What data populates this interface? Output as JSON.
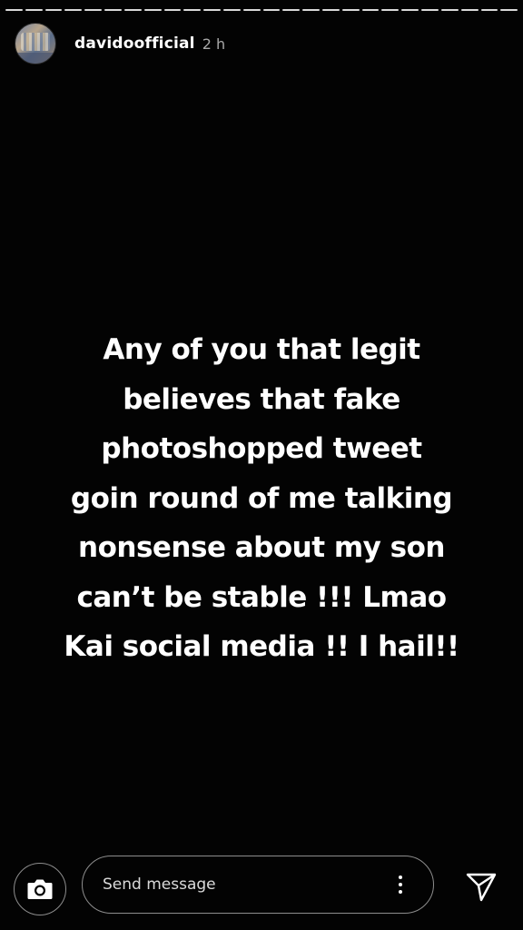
{
  "progress": {
    "segments": 26
  },
  "header": {
    "username": "davidoofficial",
    "time": "2 h"
  },
  "story": {
    "lines": [
      "Any of you that legit",
      "believes that fake",
      "photoshopped tweet",
      "goin round of me talking",
      "nonsense about my son",
      "can’t be stable !!! Lmao",
      "Kai social media !! I hail!!"
    ]
  },
  "footer": {
    "message_placeholder": "Send message",
    "camera_icon": "camera-icon",
    "more_icon": "more-vertical-icon",
    "send_icon": "send-icon"
  },
  "colors": {
    "background": "#030303",
    "text": "#ffffff"
  }
}
